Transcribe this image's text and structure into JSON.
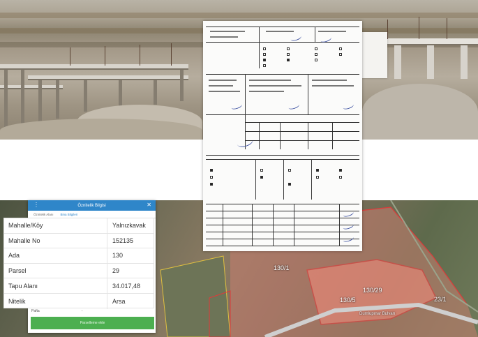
{
  "attribute_panel": {
    "title": "Öznitelik Bilgisi",
    "tabs": [
      "Öznitelik Alanı",
      "Bina Bilgileri"
    ],
    "rows": [
      {
        "key": "Mahalle/Köy",
        "value": "Yalnızkavak"
      },
      {
        "key": "Mahalle No",
        "value": "152135"
      },
      {
        "key": "Ada",
        "value": "130"
      },
      {
        "key": "Parsel",
        "value": "29"
      },
      {
        "key": "Tapu Alanı",
        "value": "34.017,48"
      },
      {
        "key": "Nitelik",
        "value": "Arsa"
      }
    ],
    "footer_label": "Pafta",
    "footer_value": "-",
    "button_label": "Parselleme ekle"
  },
  "map": {
    "parcel_labels": [
      "130/1",
      "130/29",
      "130/5",
      "23/1"
    ],
    "road_label": "Dumlupınar Bulvarı"
  },
  "colors": {
    "panel_header": "#2f86c9",
    "button_green": "#4caf50",
    "parcel_outline": "#e03a3a",
    "parcel_fill": "#f08a7a"
  }
}
